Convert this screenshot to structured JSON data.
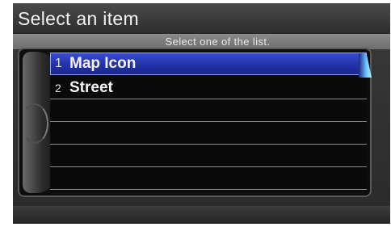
{
  "screen": {
    "title": "Select an item",
    "instruction": "Select one of the list."
  },
  "list": {
    "items": [
      {
        "number": "1",
        "label": "Map Icon",
        "selected": true
      },
      {
        "number": "2",
        "label": "Street",
        "selected": false
      }
    ],
    "empty_rows": 4
  },
  "colors": {
    "highlight": "#2233a8",
    "background": "#2a2a2a",
    "text": "#f5f5f5"
  }
}
